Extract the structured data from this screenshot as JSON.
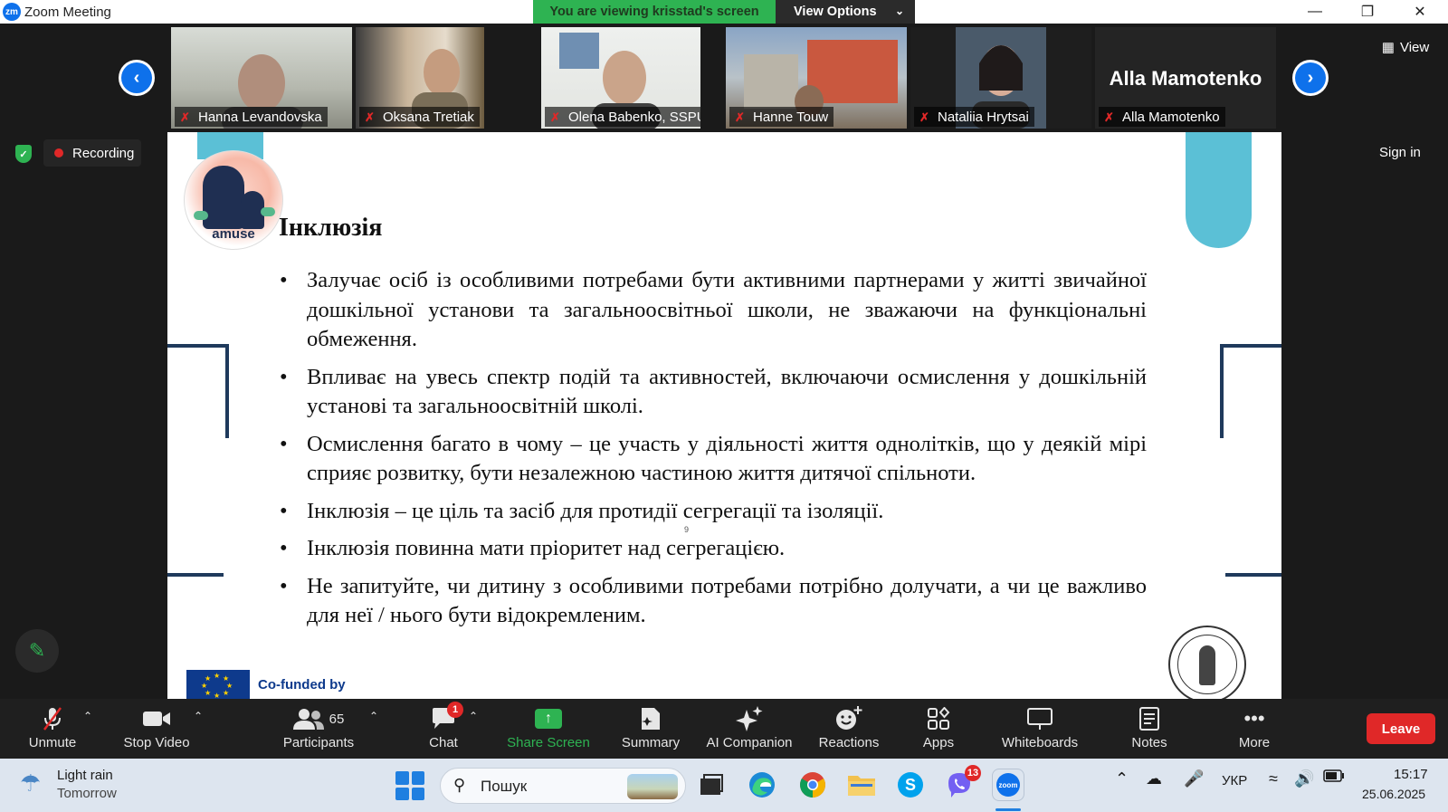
{
  "window": {
    "title": "Zoom Meeting",
    "app_logo": "zm",
    "share_banner": "You are viewing krisstad's screen",
    "view_options": "View Options"
  },
  "gallery": {
    "participants": [
      {
        "name": "Hanna Levandovska"
      },
      {
        "name": "Oksana Tretiak"
      },
      {
        "name": "Olena Babenko, SSPU"
      },
      {
        "name": "Hanne Touw"
      },
      {
        "name": "Nataliia Hrytsai"
      },
      {
        "name": "Alla Mamotenko"
      }
    ],
    "name_only_tile": "Alla Mamotenko",
    "view_label": "View"
  },
  "status": {
    "recording": "Recording",
    "sign_in": "Sign in"
  },
  "slide": {
    "logo_text": "amuse",
    "title": "Інклюзія",
    "bullets": [
      "Залучає осіб із особливими потребами бути активними партнерами у житті звичайної дошкільної установи та загальноосвітньої школи, не зважаючи на функціональні обмеження.",
      "Впливає на увесь спектр подій та активностей, включаючи осмислення у дошкільній установі та загальноосвітній школі.",
      "Осмислення багато в чому – це участь у діяльності життя однолітків, що у деякій мірі сприяє розвитку, бути незалежною частиною життя дитячої спільноти.",
      "Інклюзія – це ціль та засіб для протидії сегрегації та ізоляції.",
      "Інклюзія повинна мати пріоритет над сегрегацією.",
      "Не запитуйте, чи дитину з особливими потребами потрібно долучати, а чи це важливо для неї / нього бути відокремленим."
    ],
    "page_number": "9",
    "cofunded": "Co-funded by"
  },
  "toolbar": {
    "unmute": "Unmute",
    "stop_video": "Stop Video",
    "participants": "Participants",
    "participants_count": "65",
    "chat": "Chat",
    "chat_badge": "1",
    "share_screen": "Share Screen",
    "summary": "Summary",
    "ai_companion": "AI Companion",
    "reactions": "Reactions",
    "apps": "Apps",
    "whiteboards": "Whiteboards",
    "notes": "Notes",
    "more": "More",
    "leave": "Leave"
  },
  "taskbar": {
    "weather_line1": "Light rain",
    "weather_line2": "Tomorrow",
    "search_placeholder": "Пошук",
    "viber_badge": "13",
    "language": "УКР",
    "time": "15:17",
    "date": "25.06.2025"
  },
  "colors": {
    "zoom_blue": "#0e71eb",
    "share_green": "#2eb352",
    "leave_red": "#e02828",
    "slide_accent": "#5bc0d6",
    "slide_line": "#1f3a5c"
  }
}
